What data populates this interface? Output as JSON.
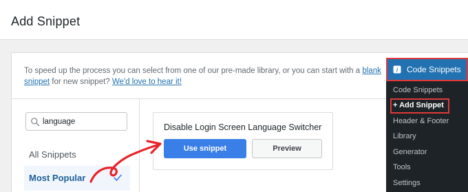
{
  "header": {
    "title": "Add Snippet"
  },
  "intro": {
    "text_before": "To speed up the process you can select from one of our pre-made library, or you can start with a ",
    "link_blank": "blank snippet",
    "text_middle": " for new snippet? ",
    "link_feedback": "We'd love to hear it!"
  },
  "search": {
    "value": "language",
    "placeholder": ""
  },
  "categories": [
    {
      "label": "All Snippets",
      "selected": false
    },
    {
      "label": "Most Popular",
      "selected": true
    }
  ],
  "snippet": {
    "title": "Disable Login Screen Language Switcher",
    "use_label": "Use snippet",
    "preview_label": "Preview"
  },
  "admin_menu": {
    "head": "Code Snippets",
    "items": [
      {
        "label": "Code Snippets"
      },
      {
        "label": "+ Add Snippet"
      },
      {
        "label": "Header & Footer"
      },
      {
        "label": "Library"
      },
      {
        "label": "Generator"
      },
      {
        "label": "Tools"
      },
      {
        "label": "Settings"
      }
    ]
  },
  "colors": {
    "accent": "#2271b1",
    "button_primary": "#3a7ee8",
    "highlight_red": "#e03a3a",
    "menu_bg": "#1d2327"
  }
}
